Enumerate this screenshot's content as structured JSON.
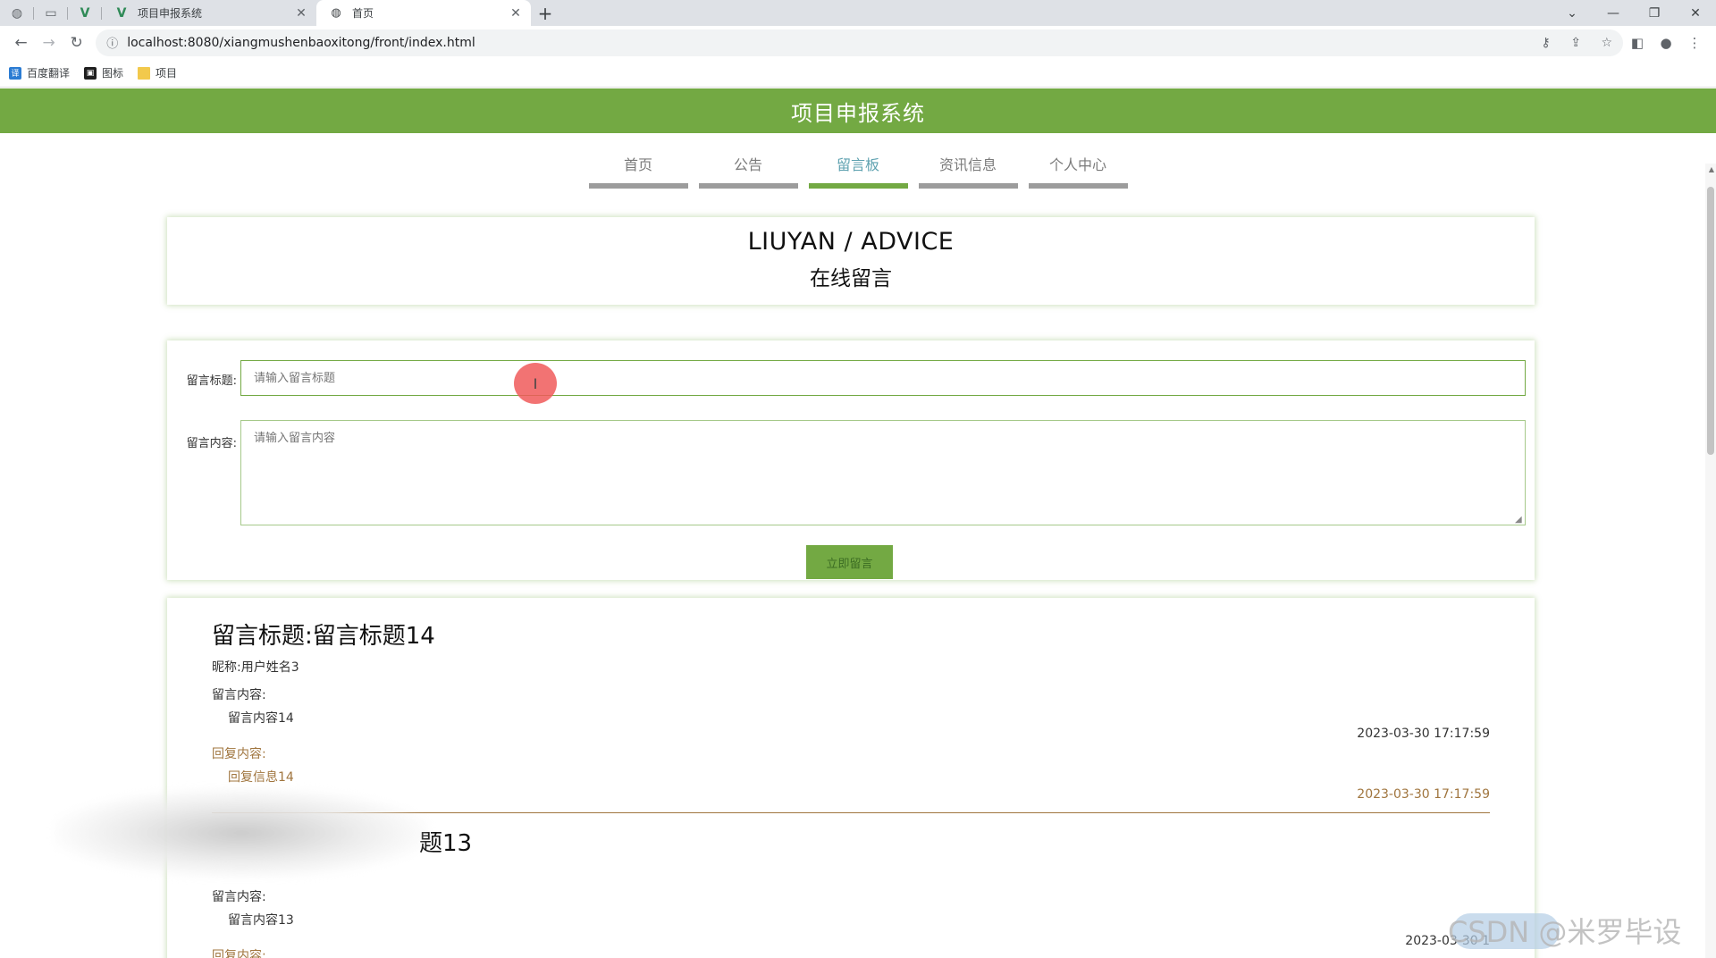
{
  "browser": {
    "tabs": [
      {
        "title": "项目申报系统",
        "active": false
      },
      {
        "title": "首页",
        "active": true
      }
    ],
    "new_tab_label": "+",
    "url": "localhost:8080/xiangmushenbaoxitong/front/index.html",
    "bookmarks": [
      {
        "label": "百度翻译"
      },
      {
        "label": "图标"
      },
      {
        "label": "项目"
      }
    ],
    "window_controls": {
      "minimize": "—",
      "restore": "❐",
      "close": "✕"
    }
  },
  "site": {
    "title": "项目申报系统",
    "nav": [
      {
        "label": "首页",
        "active": false
      },
      {
        "label": "公告",
        "active": false
      },
      {
        "label": "留言板",
        "active": true
      },
      {
        "label": "资讯信息",
        "active": false
      },
      {
        "label": "个人中心",
        "active": false
      }
    ]
  },
  "board": {
    "title_en": "LIUYAN / ADVICE",
    "title_cn": "在线留言"
  },
  "form": {
    "title_label": "留言标题:",
    "title_placeholder": "请输入留言标题",
    "content_label": "留言内容:",
    "content_placeholder": "请输入留言内容",
    "submit_label": "立即留言"
  },
  "messages": [
    {
      "title": "留言标题:留言标题14",
      "nickname": "昵称:用户姓名3",
      "content_label": "留言内容:",
      "content": "留言内容14",
      "time": "2023-03-30 17:17:59",
      "reply_label": "回复内容:",
      "reply": "回复信息14",
      "reply_time": "2023-03-30 17:17:59"
    },
    {
      "title": "题13",
      "content_label": "留言内容:",
      "content": "留言内容13",
      "time": "2023-03-30 1",
      "reply_label": "回复内容:"
    }
  ],
  "watermark": "CSDN @米罗毕设",
  "colors": {
    "brand_green": "#73a943",
    "nav_active_text": "#5fa2b0",
    "reply_brown": "#a0753e"
  }
}
